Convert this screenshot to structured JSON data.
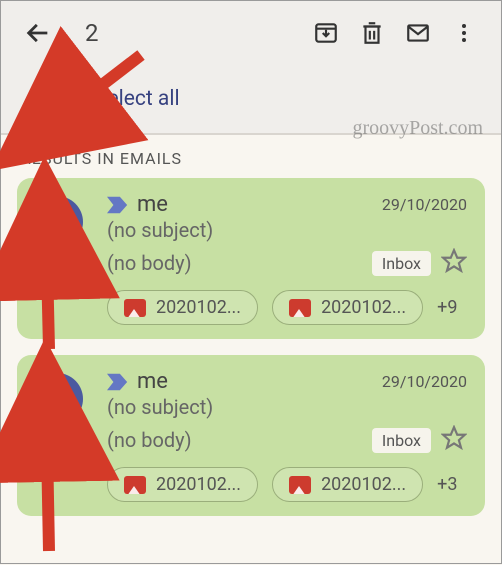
{
  "toolbar": {
    "selected_count": "2"
  },
  "select_all_label": "Select all",
  "section_header": "RESULTS IN EMAILS",
  "watermark": "groovyPost.com",
  "emails": [
    {
      "sender": "me",
      "date": "29/10/2020",
      "subject": "(no subject)",
      "body": "(no body)",
      "label": "Inbox",
      "attachments": [
        {
          "name": "2020102..."
        },
        {
          "name": "2020102..."
        }
      ],
      "more_count": "+9"
    },
    {
      "sender": "me",
      "date": "29/10/2020",
      "subject": "(no subject)",
      "body": "(no body)",
      "label": "Inbox",
      "attachments": [
        {
          "name": "2020102..."
        },
        {
          "name": "2020102..."
        }
      ],
      "more_count": "+3"
    }
  ]
}
